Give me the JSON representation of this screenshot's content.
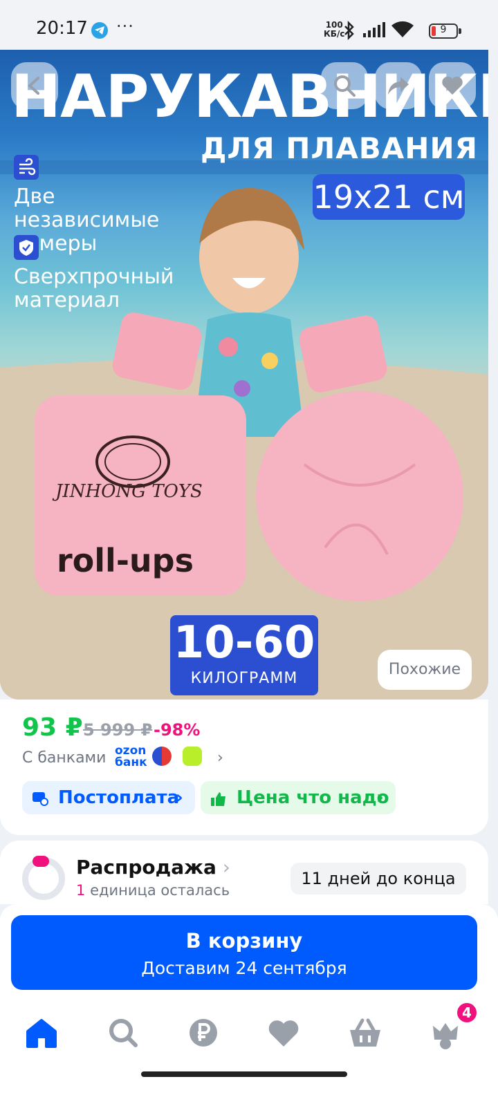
{
  "status_bar": {
    "time": "20:17",
    "more": "···",
    "speed_value": "100",
    "speed_unit": "КБ/с",
    "battery": "9",
    "icons": [
      "telegram-icon",
      "bluetooth-icon",
      "signal-icon",
      "wifi-icon",
      "battery-icon"
    ]
  },
  "hero": {
    "title": "НАРУКАВНИКИ",
    "subtitle": "ДЛЯ ПЛАВАНИЯ",
    "size": "19x21 см",
    "feature_1": "Две независимые камеры",
    "feature_2": "Сверхпрочный материал",
    "weight_range": "10-60",
    "weight_unit": "КИЛОГРАММ",
    "similar_button": "Похожие",
    "brand_text": "JINHONG TOYS",
    "product_text": "roll-ups"
  },
  "price": {
    "current": "93 ₽",
    "old": "5 999 ₽",
    "discount": "-98%",
    "banks_label": "С банками",
    "ozon_line1": "ozon",
    "ozon_line2": "банк",
    "postpay": "Постоплата",
    "fair_price": "Цена что надо"
  },
  "sale": {
    "title": "Распродажа",
    "count": "1",
    "remaining": "единица осталась",
    "days_left": "11 дней до конца"
  },
  "cart": {
    "title": "В корзину",
    "delivery": "Доставим 24 сентября"
  },
  "nav": {
    "items": [
      "home-icon",
      "search-icon",
      "ruble-icon",
      "heart-icon",
      "basket-icon",
      "profile-icon"
    ],
    "cart_badge": "4"
  },
  "colors": {
    "accent_blue": "#005bff",
    "price_green": "#10c44c",
    "discount_pink": "#f1117e"
  }
}
